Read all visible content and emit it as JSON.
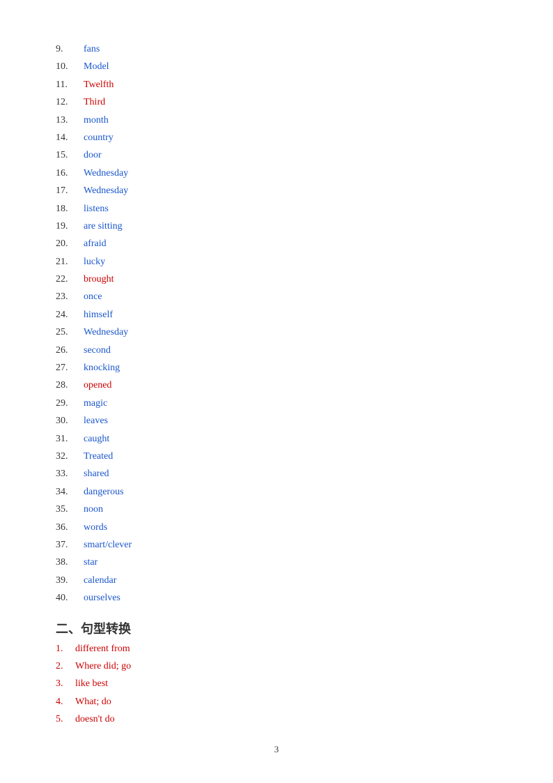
{
  "items": [
    {
      "number": "9.",
      "answer": "fans",
      "color": "blue"
    },
    {
      "number": "10.",
      "answer": "Model",
      "color": "blue"
    },
    {
      "number": "11.",
      "answer": "Twelfth",
      "color": "red"
    },
    {
      "number": "12.",
      "answer": "Third",
      "color": "red"
    },
    {
      "number": "13.",
      "answer": "month",
      "color": "blue"
    },
    {
      "number": "14.",
      "answer": "country",
      "color": "blue"
    },
    {
      "number": "15.",
      "answer": "door",
      "color": "blue"
    },
    {
      "number": "16.",
      "answer": "Wednesday",
      "color": "blue"
    },
    {
      "number": "17.",
      "answer": "Wednesday",
      "color": "blue"
    },
    {
      "number": "18.",
      "answer": "listens",
      "color": "blue"
    },
    {
      "number": "19.",
      "answer": "are sitting",
      "color": "blue"
    },
    {
      "number": "20.",
      "answer": "afraid",
      "color": "blue"
    },
    {
      "number": "21.",
      "answer": "lucky",
      "color": "blue"
    },
    {
      "number": "22.",
      "answer": "brought",
      "color": "red"
    },
    {
      "number": "23.",
      "answer": "once",
      "color": "blue"
    },
    {
      "number": "24.",
      "answer": "himself",
      "color": "blue"
    },
    {
      "number": "25.",
      "answer": "Wednesday",
      "color": "blue"
    },
    {
      "number": "26.",
      "answer": "second",
      "color": "blue"
    },
    {
      "number": "27.",
      "answer": "knocking",
      "color": "blue"
    },
    {
      "number": "28.",
      "answer": "opened",
      "color": "red"
    },
    {
      "number": "29.",
      "answer": "magic",
      "color": "blue"
    },
    {
      "number": "30.",
      "answer": "leaves",
      "color": "blue"
    },
    {
      "number": "31.",
      "answer": "caught",
      "color": "blue"
    },
    {
      "number": "32.",
      "answer": "Treated",
      "color": "blue"
    },
    {
      "number": "33.",
      "answer": "shared",
      "color": "blue"
    },
    {
      "number": "34.",
      "answer": "dangerous",
      "color": "blue"
    },
    {
      "number": "35.",
      "answer": "noon",
      "color": "blue"
    },
    {
      "number": "36.",
      "answer": "words",
      "color": "blue"
    },
    {
      "number": "37.",
      "answer": "smart/clever",
      "color": "blue"
    },
    {
      "number": "38.",
      "answer": "star",
      "color": "blue"
    },
    {
      "number": "39.",
      "answer": "calendar",
      "color": "blue"
    },
    {
      "number": "40.",
      "answer": "ourselves",
      "color": "blue"
    }
  ],
  "section_title": "二、句型转换",
  "sub_items": [
    {
      "number": "1.",
      "answer": "different from"
    },
    {
      "number": "2.",
      "answer": "Where did; go"
    },
    {
      "number": "3.",
      "answer": "like best"
    },
    {
      "number": "4.",
      "answer": "What; do"
    },
    {
      "number": "5.",
      "answer": "doesn't do"
    }
  ],
  "page_number": "3"
}
